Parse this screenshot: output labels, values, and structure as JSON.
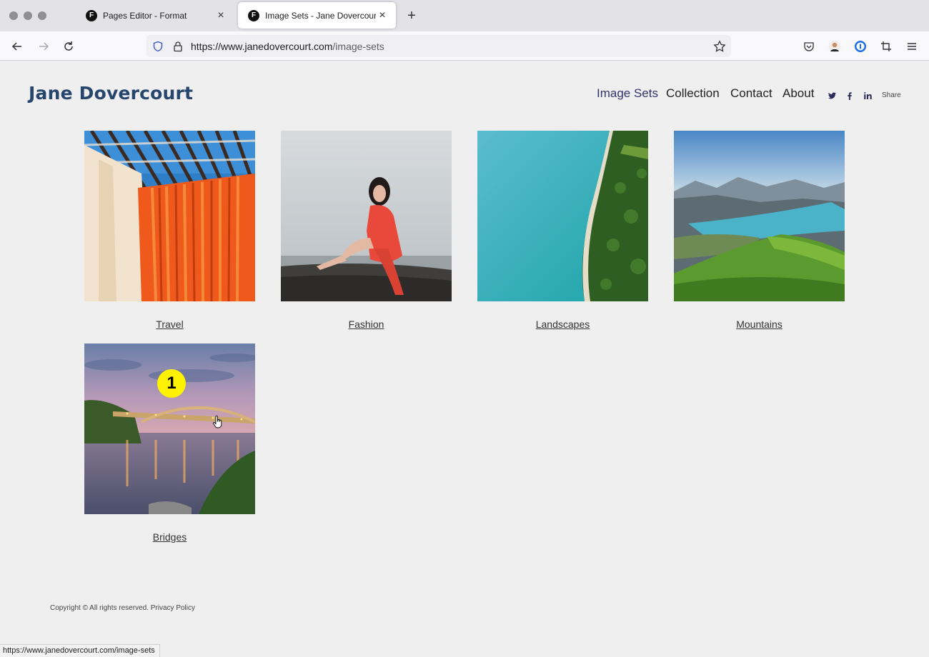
{
  "browser": {
    "tabs": [
      {
        "favicon": "F",
        "title": "Pages Editor - Format",
        "active": false
      },
      {
        "favicon": "F",
        "title": "Image Sets - Jane Dovercourt",
        "active": true
      }
    ],
    "new_tab_icon": "plus-icon",
    "url": {
      "domain": "https://www.janedovercourt.com",
      "path": "/image-sets"
    },
    "status_url": "https://www.janedovercourt.com/image-sets"
  },
  "site": {
    "title": "Jane Dovercourt",
    "nav": [
      {
        "label": "Image Sets",
        "active": true
      },
      {
        "label": "Collection",
        "active": false
      },
      {
        "label": "Contact",
        "active": false
      },
      {
        "label": "About",
        "active": false
      }
    ],
    "social": [
      "twitter-icon",
      "facebook-icon",
      "linkedin-icon"
    ],
    "share_label": "Share",
    "accent_color": "#26466e"
  },
  "gallery": {
    "items": [
      {
        "label": "Travel"
      },
      {
        "label": "Fashion"
      },
      {
        "label": "Landscapes"
      },
      {
        "label": "Mountains"
      },
      {
        "label": "Bridges"
      }
    ]
  },
  "footer": {
    "copyright": "Copyright © All rights reserved.",
    "privacy": "Privacy Policy"
  },
  "annotation": {
    "marker": "1"
  }
}
